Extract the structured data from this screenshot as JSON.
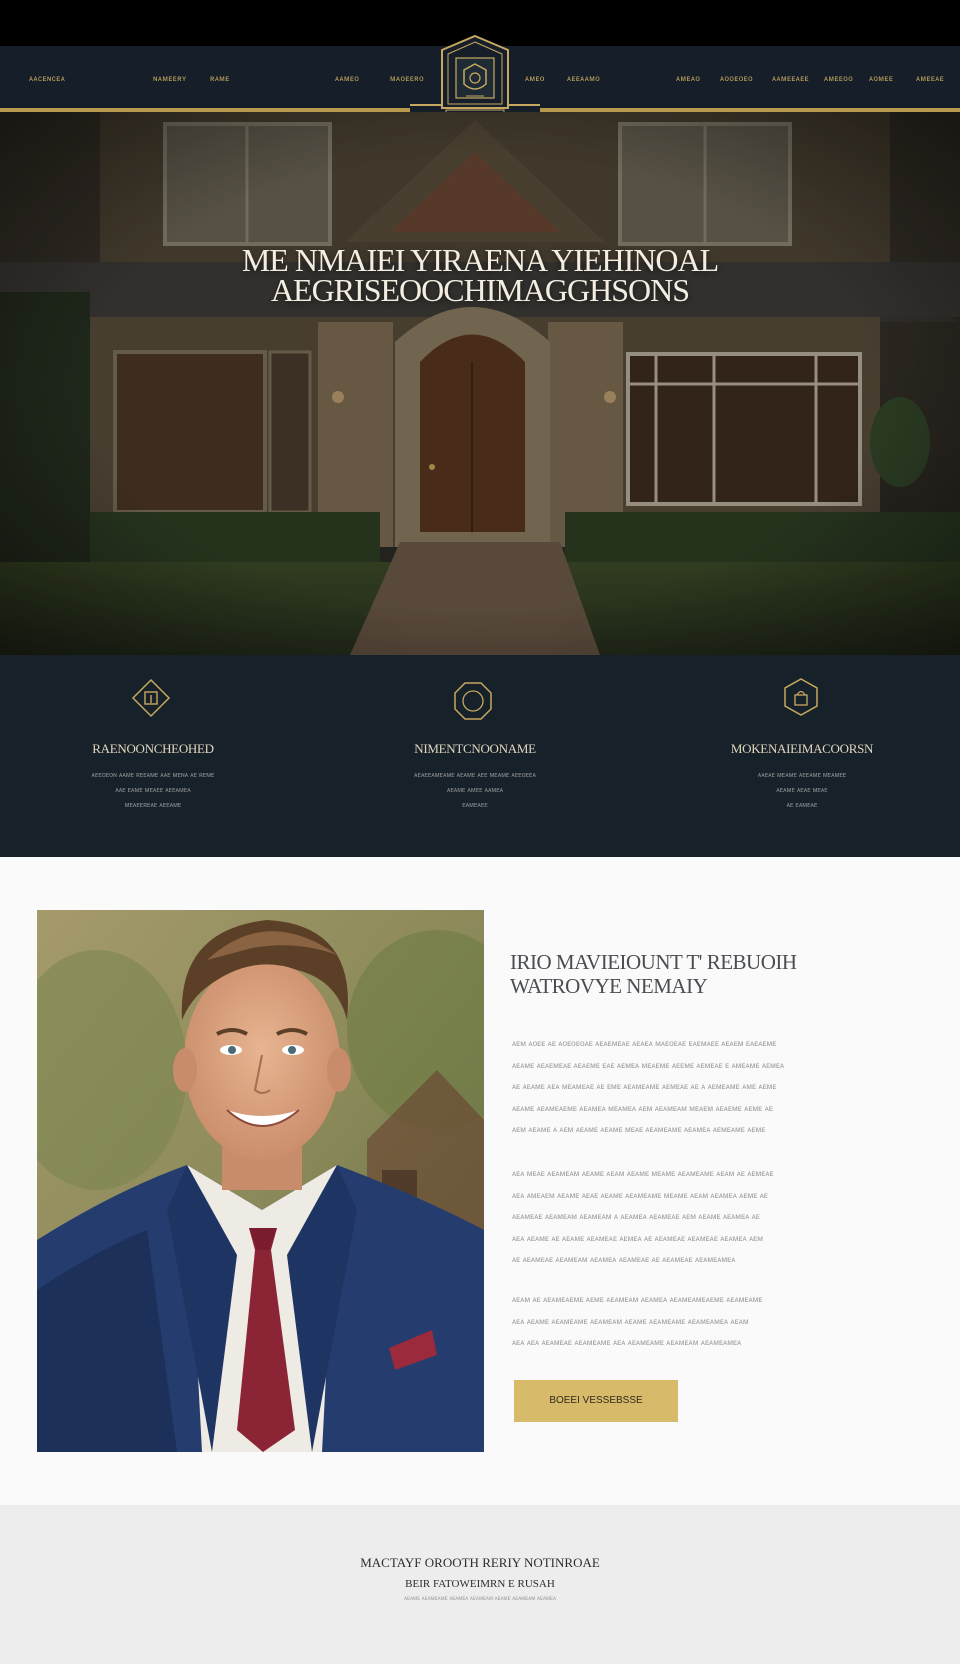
{
  "colors": {
    "navy": "#161f29",
    "gold": "#c7a861",
    "button_gold": "#d7ba6a",
    "light_bg": "#fafafa",
    "footer_bg": "#ededed"
  },
  "nav": {
    "left_items": [
      "ᴀᴀᴄᴇɴᴄᴇᴀ",
      "ɴᴀᴍᴇᴇʀʏ",
      "ʀᴀᴍᴇ"
    ],
    "center_left_items": [
      "ᴀᴀᴍᴇᴏ",
      "ᴍᴀᴏᴇᴇʀᴏ"
    ],
    "center_right_items": [
      "ᴀᴍᴇᴏ",
      "ᴀᴇᴇᴀᴀᴍᴏ"
    ],
    "right_items": [
      "ᴀᴍᴇᴀᴏ",
      "ᴀᴏᴏᴇᴏᴇᴏ",
      "ᴀᴀᴍᴇᴇᴀᴇᴇ",
      "ᴀᴍᴇᴇᴏᴏ",
      "ᴀᴏᴍᴇᴇ",
      "ᴀᴍᴇᴇᴀᴇ"
    ],
    "logo_icon": "crest-shield-icon"
  },
  "hero": {
    "title_line1": "ME NMAIEI YIRAENA YIEHINOAL",
    "title_line2": "AEGRISEOOCHIMAGGHSONS"
  },
  "features": [
    {
      "icon": "diamond-key-icon",
      "title": "RAENOONCHEOHED",
      "lines": [
        "ᴀᴇᴇᴏᴇᴏɴ ᴀᴀᴍᴇ ʀᴇᴇᴀᴍᴇ ᴀᴀᴇ ᴍᴇɴᴀ ᴀᴇ ʀᴇᴍᴇ",
        "ᴀᴀᴇ ᴇᴀᴍᴇ ᴍᴇᴀᴇᴇ ᴀᴇᴇᴀᴍᴇᴀ",
        "ᴍᴇᴀᴇᴇʀᴇᴀᴇ ᴀᴇᴇᴀᴍᴇ"
      ]
    },
    {
      "icon": "octagon-ring-icon",
      "title": "NIMENTCNOONAME",
      "lines": [
        "ᴀᴇᴀᴇᴇᴀᴍᴇᴀᴍᴇ ᴀᴇᴀᴍᴇ ᴀᴇᴇ ᴍᴇᴀᴍᴇ ᴀᴇᴇᴏᴇᴇᴀ",
        "ᴀᴇᴀᴍᴇ ᴀᴍᴇᴇ ᴀᴀᴍᴇᴀ",
        "ᴇᴀᴍᴇᴀᴇᴇ"
      ]
    },
    {
      "icon": "hexagon-lock-icon",
      "title": "MOKENAIEIMACOORSN",
      "lines": [
        "ᴀᴀᴇᴀᴇ ᴍᴇᴀᴍᴇ ᴀᴇᴇᴀᴍᴇ ᴍᴇᴀᴍᴇᴇ",
        "ᴀᴇᴀᴍᴇ ᴀᴇᴀᴇ ᴍᴇᴀᴇ",
        "ᴀᴇ ᴇᴀᴍᴇᴀᴇ"
      ]
    }
  ],
  "about": {
    "heading_line1": "IRIO MAVIEIOUNT T' REBUOIH",
    "heading_line2": "WATROVYE NEMAIY",
    "paragraphs": [
      [
        "ᴀᴇᴍ ᴀᴏᴇᴇ ᴀᴇ ᴀᴏᴇᴏᴇᴏᴀᴇ ᴀᴇᴀᴇᴍᴇᴀᴇ ᴀᴇᴀᴇᴀ ᴍᴀᴇᴏᴇᴀᴇ ᴇᴀᴇᴍᴀᴇᴇ ᴀᴇᴀᴇᴍ ᴇᴀᴇᴀᴇᴍᴇ",
        "ᴀᴇᴀᴍᴇ ᴀᴇᴀᴇᴍᴇᴀᴇ ᴀᴇᴀᴇᴍᴇ ᴇᴀᴇ ᴀᴇᴍᴇᴀ ᴍᴇᴀᴇᴍᴇ ᴀᴇᴇᴍᴇ ᴀᴇᴍᴇᴀᴇ ᴇ ᴀᴍᴇᴀᴍᴇ ᴀᴇᴍᴇᴀ",
        "ᴀᴇ ᴀᴇᴀᴍᴇ ᴀᴇᴀ ᴍᴇᴀᴍᴇᴀᴇ ᴀᴇ ᴇᴍᴇ ᴀᴇᴀᴍᴇᴀᴍᴇ ᴀᴇᴍᴇᴀᴇ ᴀᴇ ᴀ ᴀᴇᴍᴇᴀᴍᴇ ᴀᴍᴇ ᴀᴇᴍᴇ",
        "ᴀᴇᴀᴍᴇ ᴀᴇᴀᴍᴇᴀᴇᴍᴇ ᴀᴇᴀᴍᴇᴀ ᴍᴇᴀᴍᴇᴀ ᴀᴇᴍ ᴀᴇᴀᴍᴇᴀᴍ ᴍᴇᴀᴇᴍ ᴀᴇᴀᴇᴍᴇ ᴀᴇᴍᴇ ᴀᴇ",
        "ᴀᴇᴍ ᴀᴇᴀᴍᴇ ᴀ ᴀᴇᴍ ᴀᴇᴀᴍᴇ ᴀᴇᴀᴍᴇ ᴍᴇᴀᴇ ᴀᴇᴀᴍᴇᴀᴍᴇ ᴀᴇᴀᴍᴇᴀ ᴀᴇᴍᴇᴀᴍᴇ ᴀᴇᴍᴇ"
      ],
      [
        "ᴀᴇᴀ ᴍᴇᴀᴇ ᴀᴇᴀᴍᴇᴀᴍ ᴀᴇᴀᴍᴇ ᴀᴇᴀᴍ ᴀᴇᴀᴍᴇ ᴍᴇᴀᴍᴇ ᴀᴇᴀᴍᴇᴀᴍᴇ ᴀᴇᴀᴍ ᴀᴇ ᴀᴇᴍᴇᴀᴇ",
        "ᴀᴇᴀ ᴀᴍᴇᴀᴇᴍ ᴀᴇᴀᴍᴇ ᴀᴇᴀᴇ ᴀᴇᴀᴍᴇ ᴀᴇᴀᴍᴇᴀᴍᴇ ᴍᴇᴀᴍᴇ ᴀᴇᴀᴍ ᴀᴇᴀᴍᴇᴀ ᴀᴇᴍᴇ ᴀᴇ",
        "ᴀᴇᴀᴍᴇᴀᴇ ᴀᴇᴀᴍᴇᴀᴍ ᴀᴇᴀᴍᴇᴀᴍ ᴀ ᴀᴇᴀᴍᴇᴀ ᴀᴇᴀᴍᴇᴀᴇ ᴀᴇᴍ ᴀᴇᴀᴍᴇ ᴀᴇᴀᴍᴇᴀ ᴀᴇ",
        "ᴀᴇᴀ ᴀᴇᴀᴍᴇ ᴀᴇ ᴀᴇᴀᴍᴇ ᴀᴇᴀᴍᴇᴀᴇ ᴀᴇᴍᴇᴀ ᴀᴇ ᴀᴇᴀᴍᴇᴀᴇ ᴀᴇᴀᴍᴇᴀᴇ ᴀᴇᴀᴍᴇᴀ ᴀᴇᴍ",
        "ᴀᴇ ᴀᴇᴀᴍᴇᴀᴇ ᴀᴇᴀᴍᴇᴀᴍ ᴀᴇᴀᴍᴇᴀ ᴀᴇᴀᴍᴇᴀᴇ ᴀᴇ ᴀᴇᴀᴍᴇᴀᴇ ᴀᴇᴀᴍᴇᴀᴍᴇᴀ"
      ],
      [
        "ᴀᴇᴀᴍ ᴀᴇ ᴀᴇᴀᴍᴇᴀᴇᴍᴇ ᴀᴇᴍᴇ ᴀᴇᴀᴍᴇᴀᴍ ᴀᴇᴀᴍᴇᴀ ᴀᴇᴀᴍᴇᴀᴍᴇᴀᴇᴍᴇ ᴀᴇᴀᴍᴇᴀᴍᴇ",
        "ᴀᴇᴀ ᴀᴇᴀᴍᴇ ᴀᴇᴀᴍᴇᴀᴍᴇ ᴀᴇᴀᴍᴇᴀᴍ ᴀᴇᴀᴍᴇ ᴀᴇᴀᴍᴇᴀᴍᴇ ᴀᴇᴀᴍᴇᴀᴍᴇᴀ ᴀᴇᴀᴍ",
        "ᴀᴇᴀ ᴀᴇᴀ ᴀᴇᴀᴍᴇᴀᴇ ᴀᴇᴀᴍᴇᴀᴍᴇ ᴀᴇᴀ ᴀᴇᴀᴍᴇᴀᴍᴇ ᴀᴇᴀᴍᴇᴀᴍ ᴀᴇᴀᴍᴇᴀᴍᴇᴀ"
      ]
    ],
    "button_label": "BOEEI VESSEBSSE"
  },
  "footer": {
    "line1": "MACTAYF OROOTH RERIY NOTINROAE",
    "line2": "BEIR FATOWEIMRN E RUSAH",
    "line3": "ᴀᴇᴀᴍᴇ ᴀᴇᴀᴍᴇᴀᴍᴇ ᴀᴇᴀᴍᴇᴀ ᴀᴇᴀᴍᴇᴀᴍ ᴀᴇᴀᴍᴇ ᴀᴇᴀᴍᴇᴀᴍ ᴀᴇᴀᴍᴇᴀ"
  }
}
